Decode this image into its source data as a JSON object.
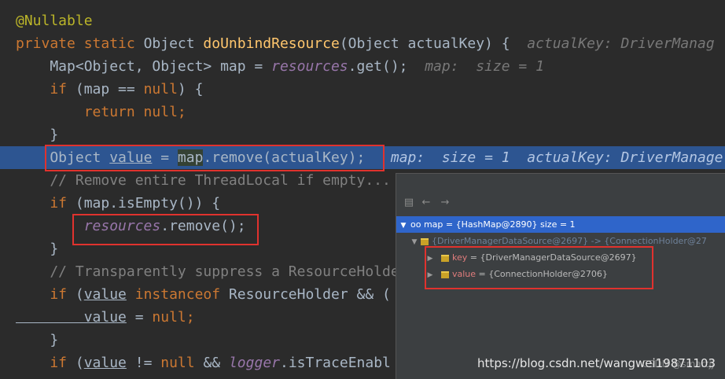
{
  "code": {
    "l0": "@Nullable",
    "l1_kw": "private static ",
    "l1_type": "Object ",
    "l1_fn": "doUnbindResource",
    "l1_params": "(Object actualKey) {",
    "l1_hint": "actualKey: DriverManag",
    "l2_a": "    Map<Object, Object> map = ",
    "l2_field": "resources",
    "l2_b": ".get();",
    "l2_hint": "map:  size = 1",
    "l3_kw": "    if ",
    "l3_a": "(map == ",
    "l3_null": "null",
    "l3_b": ") {",
    "l4_kw": "        return null",
    "l4_b": ";",
    "l5": "    }",
    "l6_a": "    Object ",
    "l6_value": "value",
    "l6_b": " = ",
    "l6_map": "map",
    "l6_c": ".remove(actualKey);",
    "l6_hint": "map:  size = 1  actualKey: DriverManage",
    "l7": "    // Remove entire ThreadLocal if empty...",
    "l8_kw": "    if ",
    "l8_a": "(map.isEmpty()) {",
    "l9_field": "        resources",
    "l9_a": ".remove();",
    "l10": "    }",
    "l11": "    // Transparently suppress a ResourceHolde",
    "l12_kw": "    if ",
    "l12_a": "(",
    "l12_value": "value",
    "l12_kw2": " instanceof ",
    "l12_b": "ResourceHolder && (",
    "l13_value": "        value",
    "l13_a": " = ",
    "l13_null": "null",
    "l13_b": ";",
    "l14": "    }",
    "l15_kw": "    if ",
    "l15_a": "(",
    "l15_value": "value",
    "l15_b": " != ",
    "l15_null": "null",
    "l15_c": " && ",
    "l15_field": "logger",
    "l15_d": ".isTraceEnabl"
  },
  "debug_popup": {
    "toolbar_icons": [
      "stack-icon",
      "back-arrow-icon",
      "forward-arrow-icon"
    ],
    "root": "oo map = {HashMap@2890}  size = 1",
    "entry": "{DriverManagerDataSource@2697} -> {ConnectionHolder@27",
    "key_name": "key",
    "key_value": " = {DriverManagerDataSource@2697}",
    "value_name": "value",
    "value_value": " = {ConnectionHolder@2706}"
  },
  "watermark": "https://blog.csdn.net/wangwei19871103",
  "watermark_overlay": "CSDN @smartjj",
  "colors": {
    "background": "#2b2b2b",
    "highlight_line": "#2d5591",
    "keyword": "#cc7832",
    "annotation": "#bbb529",
    "method": "#ffc66d",
    "field": "#9876aa",
    "comment": "#808080",
    "red_box": "#e0322e",
    "popup_selection": "#2f65ca"
  }
}
